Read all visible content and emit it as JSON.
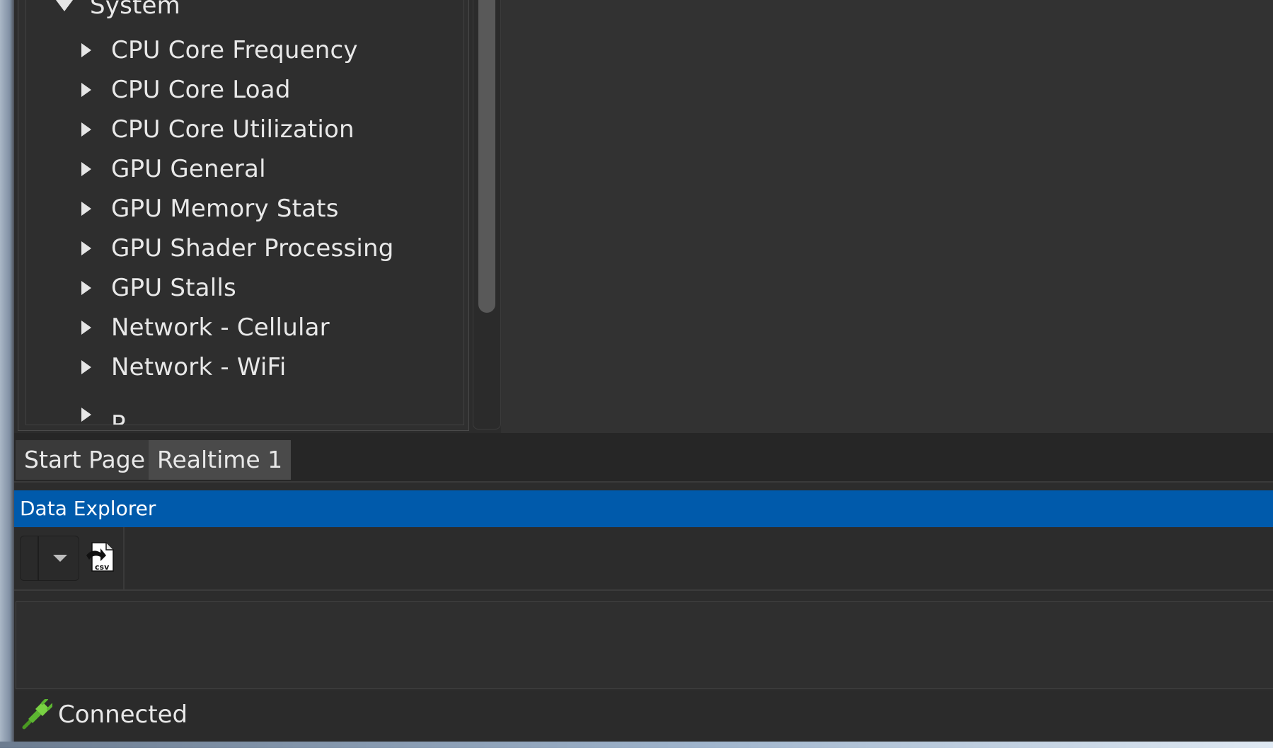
{
  "tree": {
    "root": {
      "label": "System",
      "expanded": true
    },
    "items": [
      {
        "label": "CPU Core Frequency"
      },
      {
        "label": "CPU Core Load"
      },
      {
        "label": "CPU Core Utilization"
      },
      {
        "label": "GPU General"
      },
      {
        "label": "GPU Memory Stats"
      },
      {
        "label": "GPU Shader Processing"
      },
      {
        "label": "GPU Stalls"
      },
      {
        "label": "Network - Cellular"
      },
      {
        "label": "Network - WiFi"
      },
      {
        "label": "P"
      }
    ]
  },
  "tabs": [
    {
      "label": "Start Page"
    },
    {
      "label": "Realtime 1"
    }
  ],
  "panel": {
    "title": "Data Explorer"
  },
  "toolbar": {
    "csv_icon_text": "csv"
  },
  "status": {
    "text": "Connected"
  },
  "colors": {
    "accent_blue": "#005aab",
    "status_green": "#5cb531",
    "background": "#2c2c2c",
    "text": "#e8e8e8"
  }
}
